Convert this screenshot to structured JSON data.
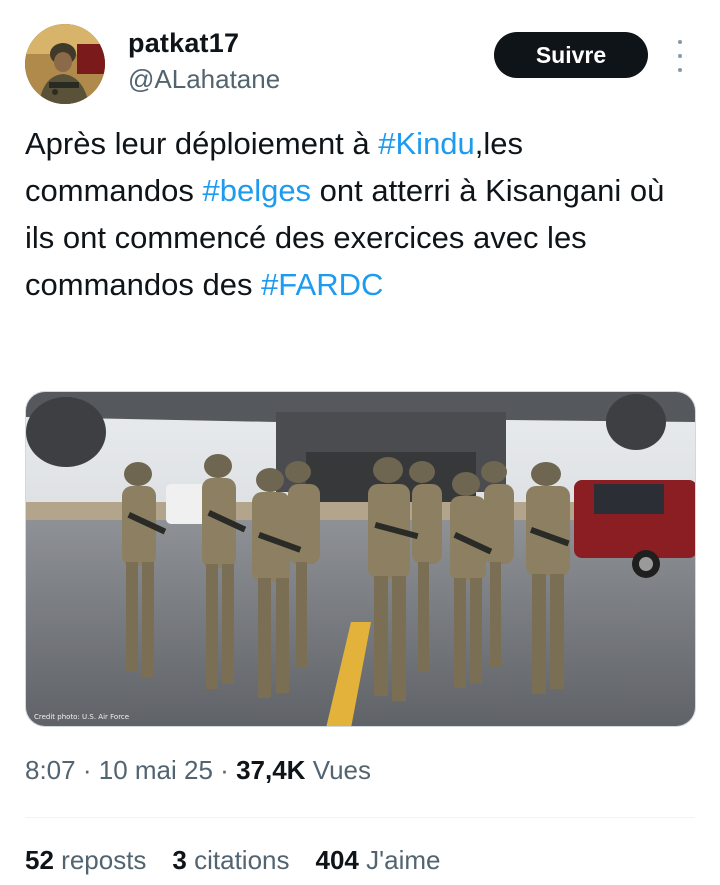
{
  "author": {
    "display_name": "patkat17",
    "handle": "@ALahatane",
    "avatar_icon": "avatar-soldier-icon"
  },
  "header": {
    "follow_label": "Suivre",
    "more_icon": "more-vertical-icon"
  },
  "tweet": {
    "text_parts": {
      "p1": "Après leur déploiement à ",
      "tag1": "#Kindu",
      "p2": ",les commandos ",
      "tag2": "#belges",
      "p3": " ont  atterri à Kisangani où ils ont  commencé des exercices avec les commandos des ",
      "tag3": "#FARDC"
    },
    "media_credit": "Credit photo: U.S. Air Force",
    "media_description_icon": "photo-soldiers-icon"
  },
  "meta": {
    "time": "8:07",
    "separator": "·",
    "date": "10 mai 25",
    "views_count": "37,4K",
    "views_label": "Vues"
  },
  "stats": {
    "reposts_count": "52",
    "reposts_label": "reposts",
    "citations_count": "3",
    "citations_label": "citations",
    "likes_count": "404",
    "likes_label": "J'aime"
  },
  "colors": {
    "link": "#1d9bf0",
    "text": "#0f1419",
    "secondary": "#536471",
    "button_bg": "#0f1419"
  }
}
